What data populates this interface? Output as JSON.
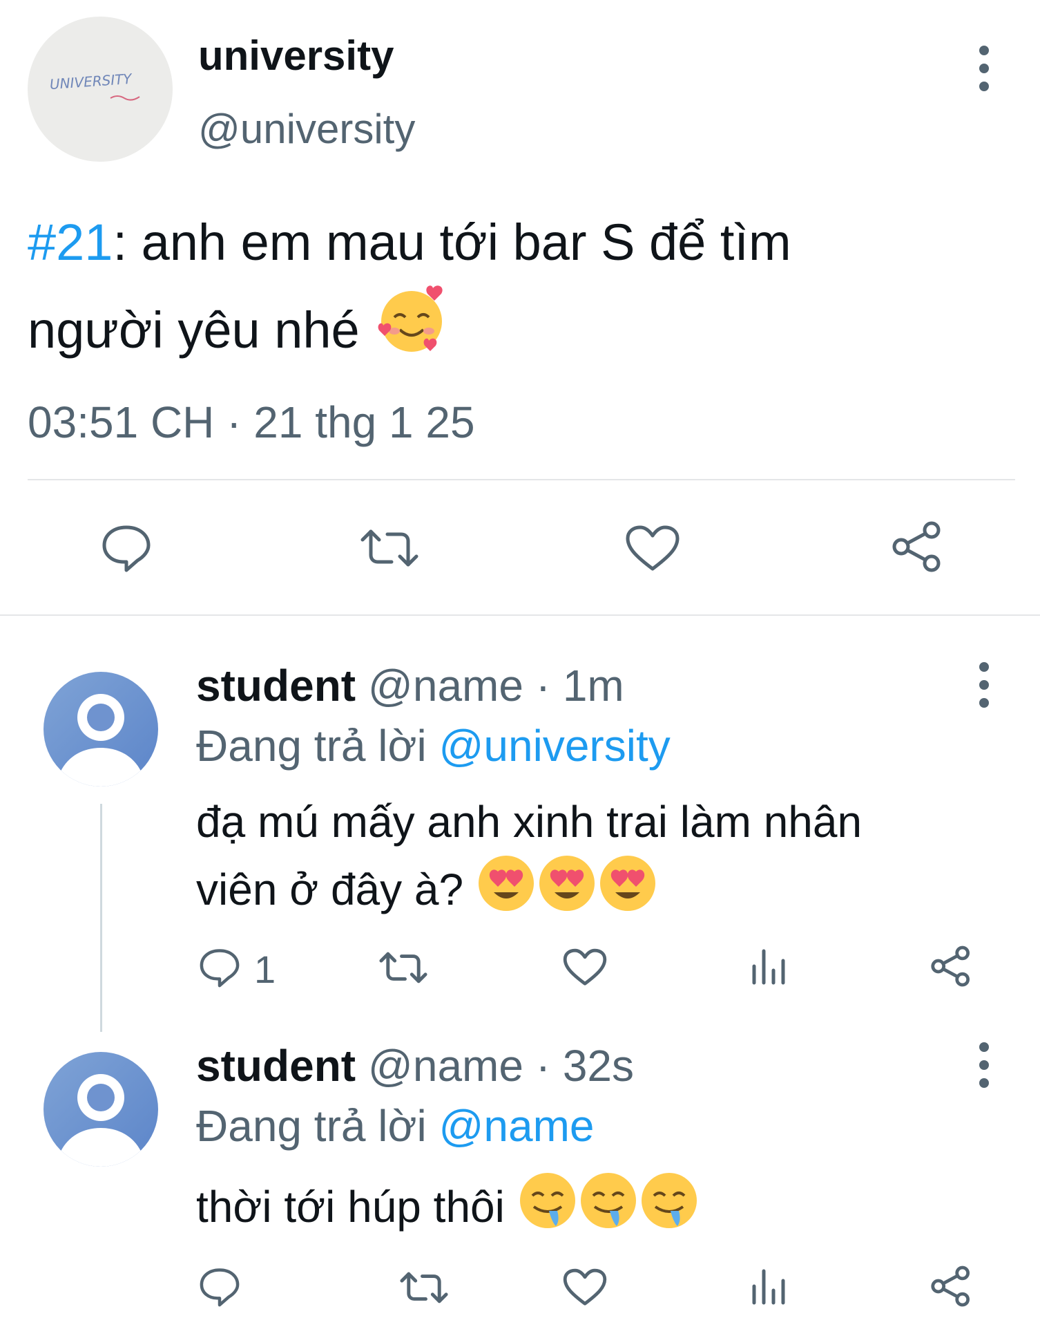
{
  "main_tweet": {
    "avatar_text": "UNIVERSITY",
    "display_name": "university",
    "handle": "@university",
    "hashtag": "#21",
    "body_rest": ": anh em mau tới bar S để tìm",
    "body_line2": "người yêu nhé",
    "emoji": "smiling-face-with-hearts",
    "timestamp": "03:51 CH · 21 thg 1 25"
  },
  "replies": [
    {
      "display_name": "student",
      "handle_time": "@name · 1m",
      "replying_prefix": "Đang trả lời",
      "replying_to": "@university",
      "text_line1": "đạ mú mấy anh xinh trai làm nhân",
      "text_line2": "viên ở đây à?",
      "emoji": "heart-eyes",
      "reply_count": "1"
    },
    {
      "display_name": "student",
      "handle_time": "@name · 32s",
      "replying_prefix": "Đang trả lời",
      "replying_to": "@name",
      "text_line1": "thời tới húp thôi",
      "emoji": "drooling-face",
      "reply_count": ""
    }
  ],
  "colors": {
    "accent": "#1d9bf0",
    "secondary_text": "#536471",
    "divider": "#e4e6e8"
  }
}
